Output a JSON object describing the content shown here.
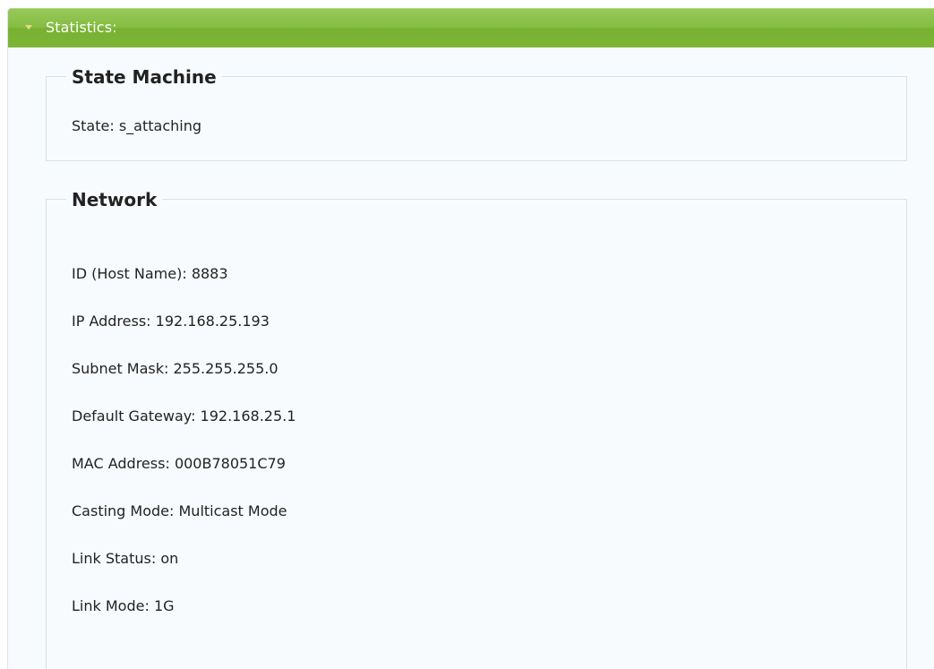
{
  "statistics": {
    "title": "Statistics:",
    "state_machine": {
      "legend": "State Machine",
      "state_label": "State:",
      "state_value": "s_attaching"
    },
    "network": {
      "legend": "Network",
      "rows": [
        {
          "label": "ID (Host Name):",
          "value": "8883"
        },
        {
          "label": "IP Address:",
          "value": "192.168.25.193"
        },
        {
          "label": "Subnet Mask:",
          "value": "255.255.255.0"
        },
        {
          "label": "Default Gateway:",
          "value": "192.168.25.1"
        },
        {
          "label": "MAC Address:",
          "value": "000B78051C79"
        },
        {
          "label": "Casting Mode:",
          "value": "Multicast Mode"
        },
        {
          "label": "Link Status:",
          "value": "on"
        },
        {
          "label": "Link Mode:",
          "value": "1G"
        }
      ]
    }
  },
  "colors": {
    "header_green": "#82b93e",
    "panel_background": "#f8fbfd",
    "fieldset_border": "#d8e2ea"
  },
  "icons": {
    "header_toggle": "triangle-down-icon"
  }
}
